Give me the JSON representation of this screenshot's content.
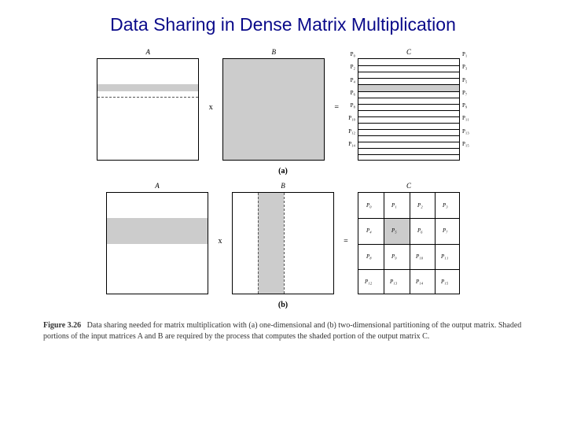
{
  "title": "Data Sharing in Dense Matrix Multiplication",
  "labels": {
    "A": "A",
    "B": "B",
    "C": "C",
    "times": "x",
    "equals": "="
  },
  "partA": {
    "sub": "(a)",
    "plabels_left": [
      "P₀",
      "P₂",
      "P₄",
      "P₆",
      "P₈",
      "P₁₀",
      "P₁₂",
      "P₁₄"
    ],
    "plabels_right": [
      "P₁",
      "P₃",
      "P₅",
      "P₇",
      "P₉",
      "P₁₁",
      "P₁₃",
      "P₁₅"
    ]
  },
  "partB": {
    "sub": "(b)",
    "cells": [
      "P₀",
      "P₁",
      "P₂",
      "P₃",
      "P₄",
      "P₅",
      "P₆",
      "P₇",
      "P₈",
      "P₉",
      "P₁₀",
      "P₁₁",
      "P₁₂",
      "P₁₃",
      "P₁₄",
      "P₁₅"
    ]
  },
  "caption": {
    "figno": "Figure 3.26",
    "text": "Data sharing needed for matrix multiplication with (a) one-dimensional and (b) two-dimensional partitioning of the output matrix. Shaded portions of the input matrices A and B are required by the process that computes the shaded portion of the output matrix C."
  }
}
